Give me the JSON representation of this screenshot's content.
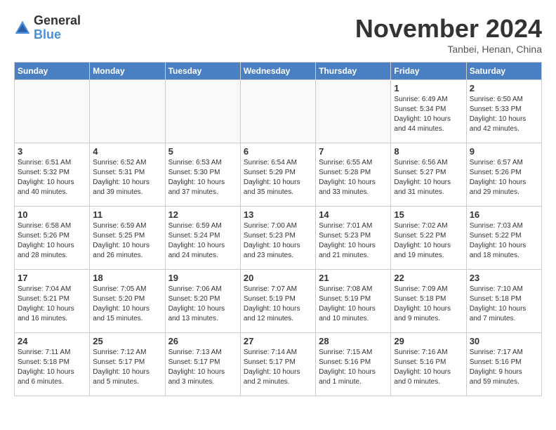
{
  "header": {
    "logo_general": "General",
    "logo_blue": "Blue",
    "month_title": "November 2024",
    "location": "Tanbei, Henan, China"
  },
  "days_of_week": [
    "Sunday",
    "Monday",
    "Tuesday",
    "Wednesday",
    "Thursday",
    "Friday",
    "Saturday"
  ],
  "weeks": [
    [
      {
        "day": "",
        "info": ""
      },
      {
        "day": "",
        "info": ""
      },
      {
        "day": "",
        "info": ""
      },
      {
        "day": "",
        "info": ""
      },
      {
        "day": "",
        "info": ""
      },
      {
        "day": "1",
        "info": "Sunrise: 6:49 AM\nSunset: 5:34 PM\nDaylight: 10 hours\nand 44 minutes."
      },
      {
        "day": "2",
        "info": "Sunrise: 6:50 AM\nSunset: 5:33 PM\nDaylight: 10 hours\nand 42 minutes."
      }
    ],
    [
      {
        "day": "3",
        "info": "Sunrise: 6:51 AM\nSunset: 5:32 PM\nDaylight: 10 hours\nand 40 minutes."
      },
      {
        "day": "4",
        "info": "Sunrise: 6:52 AM\nSunset: 5:31 PM\nDaylight: 10 hours\nand 39 minutes."
      },
      {
        "day": "5",
        "info": "Sunrise: 6:53 AM\nSunset: 5:30 PM\nDaylight: 10 hours\nand 37 minutes."
      },
      {
        "day": "6",
        "info": "Sunrise: 6:54 AM\nSunset: 5:29 PM\nDaylight: 10 hours\nand 35 minutes."
      },
      {
        "day": "7",
        "info": "Sunrise: 6:55 AM\nSunset: 5:28 PM\nDaylight: 10 hours\nand 33 minutes."
      },
      {
        "day": "8",
        "info": "Sunrise: 6:56 AM\nSunset: 5:27 PM\nDaylight: 10 hours\nand 31 minutes."
      },
      {
        "day": "9",
        "info": "Sunrise: 6:57 AM\nSunset: 5:26 PM\nDaylight: 10 hours\nand 29 minutes."
      }
    ],
    [
      {
        "day": "10",
        "info": "Sunrise: 6:58 AM\nSunset: 5:26 PM\nDaylight: 10 hours\nand 28 minutes."
      },
      {
        "day": "11",
        "info": "Sunrise: 6:59 AM\nSunset: 5:25 PM\nDaylight: 10 hours\nand 26 minutes."
      },
      {
        "day": "12",
        "info": "Sunrise: 6:59 AM\nSunset: 5:24 PM\nDaylight: 10 hours\nand 24 minutes."
      },
      {
        "day": "13",
        "info": "Sunrise: 7:00 AM\nSunset: 5:23 PM\nDaylight: 10 hours\nand 23 minutes."
      },
      {
        "day": "14",
        "info": "Sunrise: 7:01 AM\nSunset: 5:23 PM\nDaylight: 10 hours\nand 21 minutes."
      },
      {
        "day": "15",
        "info": "Sunrise: 7:02 AM\nSunset: 5:22 PM\nDaylight: 10 hours\nand 19 minutes."
      },
      {
        "day": "16",
        "info": "Sunrise: 7:03 AM\nSunset: 5:22 PM\nDaylight: 10 hours\nand 18 minutes."
      }
    ],
    [
      {
        "day": "17",
        "info": "Sunrise: 7:04 AM\nSunset: 5:21 PM\nDaylight: 10 hours\nand 16 minutes."
      },
      {
        "day": "18",
        "info": "Sunrise: 7:05 AM\nSunset: 5:20 PM\nDaylight: 10 hours\nand 15 minutes."
      },
      {
        "day": "19",
        "info": "Sunrise: 7:06 AM\nSunset: 5:20 PM\nDaylight: 10 hours\nand 13 minutes."
      },
      {
        "day": "20",
        "info": "Sunrise: 7:07 AM\nSunset: 5:19 PM\nDaylight: 10 hours\nand 12 minutes."
      },
      {
        "day": "21",
        "info": "Sunrise: 7:08 AM\nSunset: 5:19 PM\nDaylight: 10 hours\nand 10 minutes."
      },
      {
        "day": "22",
        "info": "Sunrise: 7:09 AM\nSunset: 5:18 PM\nDaylight: 10 hours\nand 9 minutes."
      },
      {
        "day": "23",
        "info": "Sunrise: 7:10 AM\nSunset: 5:18 PM\nDaylight: 10 hours\nand 7 minutes."
      }
    ],
    [
      {
        "day": "24",
        "info": "Sunrise: 7:11 AM\nSunset: 5:18 PM\nDaylight: 10 hours\nand 6 minutes."
      },
      {
        "day": "25",
        "info": "Sunrise: 7:12 AM\nSunset: 5:17 PM\nDaylight: 10 hours\nand 5 minutes."
      },
      {
        "day": "26",
        "info": "Sunrise: 7:13 AM\nSunset: 5:17 PM\nDaylight: 10 hours\nand 3 minutes."
      },
      {
        "day": "27",
        "info": "Sunrise: 7:14 AM\nSunset: 5:17 PM\nDaylight: 10 hours\nand 2 minutes."
      },
      {
        "day": "28",
        "info": "Sunrise: 7:15 AM\nSunset: 5:16 PM\nDaylight: 10 hours\nand 1 minute."
      },
      {
        "day": "29",
        "info": "Sunrise: 7:16 AM\nSunset: 5:16 PM\nDaylight: 10 hours\nand 0 minutes."
      },
      {
        "day": "30",
        "info": "Sunrise: 7:17 AM\nSunset: 5:16 PM\nDaylight: 9 hours\nand 59 minutes."
      }
    ]
  ]
}
